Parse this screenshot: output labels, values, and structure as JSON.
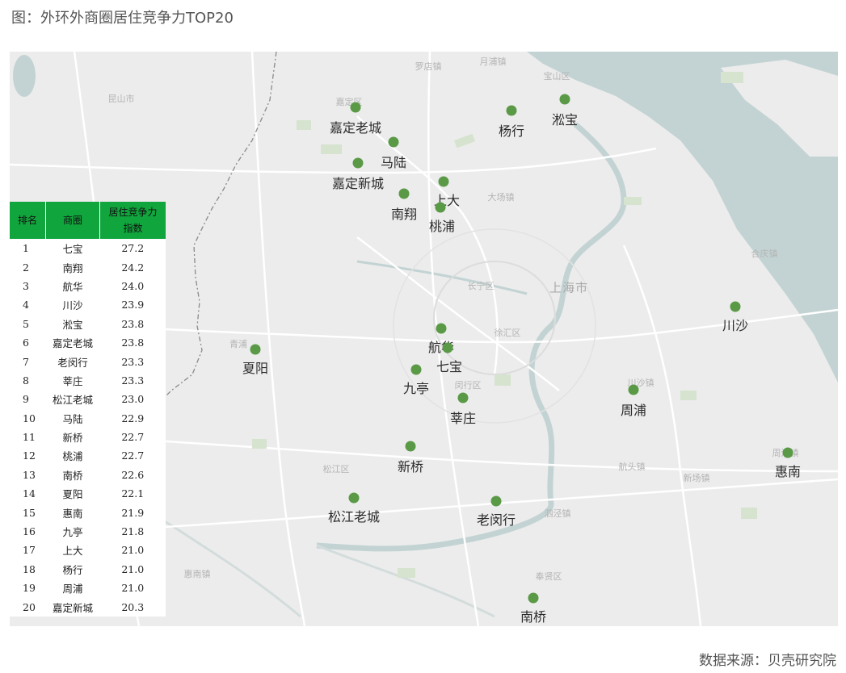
{
  "title": "图：外环外商圈居住竞争力TOP20",
  "source": "数据来源：贝壳研究院",
  "colors": {
    "marker": "#5a9a46",
    "header": "#10a53d",
    "water": "#c3d3d3",
    "land": "#ececec"
  },
  "table": {
    "headers": [
      "排名",
      "商圈",
      "居住竞争力指数"
    ],
    "header_score_line1": "居住竞争力",
    "header_score_line2": "指数",
    "rows": [
      {
        "rank": "1",
        "name": "七宝",
        "score": "27.2"
      },
      {
        "rank": "2",
        "name": "南翔",
        "score": "24.2"
      },
      {
        "rank": "3",
        "name": "航华",
        "score": "24.0"
      },
      {
        "rank": "4",
        "name": "川沙",
        "score": "23.9"
      },
      {
        "rank": "5",
        "name": "淞宝",
        "score": "23.8"
      },
      {
        "rank": "6",
        "name": "嘉定老城",
        "score": "23.8"
      },
      {
        "rank": "7",
        "name": "老闵行",
        "score": "23.3"
      },
      {
        "rank": "8",
        "name": "莘庄",
        "score": "23.3"
      },
      {
        "rank": "9",
        "name": "松江老城",
        "score": "23.0"
      },
      {
        "rank": "10",
        "name": "马陆",
        "score": "22.9"
      },
      {
        "rank": "11",
        "name": "新桥",
        "score": "22.7"
      },
      {
        "rank": "12",
        "name": "桃浦",
        "score": "22.7"
      },
      {
        "rank": "13",
        "name": "南桥",
        "score": "22.6"
      },
      {
        "rank": "14",
        "name": "夏阳",
        "score": "22.1"
      },
      {
        "rank": "15",
        "name": "惠南",
        "score": "21.9"
      },
      {
        "rank": "16",
        "name": "九亭",
        "score": "21.8"
      },
      {
        "rank": "17",
        "name": "上大",
        "score": "21.0"
      },
      {
        "rank": "18",
        "name": "杨行",
        "score": "21.0"
      },
      {
        "rank": "19",
        "name": "周浦",
        "score": "21.0"
      },
      {
        "rank": "20",
        "name": "嘉定新城",
        "score": "20.3"
      }
    ]
  },
  "map": {
    "city_label": "上海市",
    "districts": [
      "昆山市",
      "嘉定区",
      "宝山区",
      "长宁区",
      "徐汇区",
      "闵行区",
      "松江区",
      "奉贤区",
      "青浦",
      "月浦镇",
      "罗店镇",
      "大场镇",
      "合庆镇",
      "航头镇",
      "新场镇",
      "川沙镇",
      "周浦镇",
      "惠南镇",
      "泗泾镇",
      "浦江镇"
    ],
    "markers": [
      "嘉定老城",
      "杨行",
      "淞宝",
      "马陆",
      "嘉定新城",
      "上大",
      "南翔",
      "桃浦",
      "川沙",
      "航华",
      "夏阳",
      "七宝",
      "九亭",
      "莘庄",
      "周浦",
      "新桥",
      "惠南",
      "松江老城",
      "老闵行",
      "南桥"
    ]
  }
}
